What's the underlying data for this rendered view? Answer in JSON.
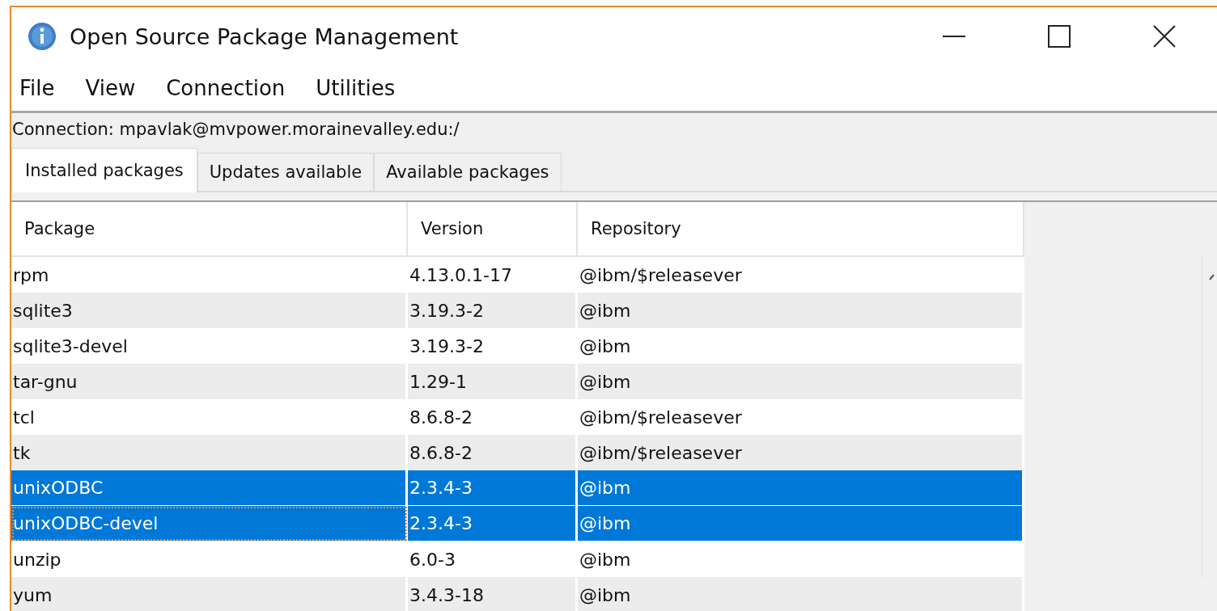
{
  "window": {
    "title": "Open Source Package Management"
  },
  "menu": [
    "File",
    "View",
    "Connection",
    "Utilities"
  ],
  "connection": "Connection: mpavlak@mvpower.morainevalley.edu:/",
  "tabs": [
    {
      "label": "Installed packages",
      "selected": true
    },
    {
      "label": "Updates available",
      "selected": false
    },
    {
      "label": "Available packages",
      "selected": false
    }
  ],
  "table": {
    "columns": [
      "Package",
      "Version",
      "Repository"
    ],
    "rows": [
      {
        "cells": [
          "rpm",
          "4.13.0.1-17",
          "@ibm/$releasever"
        ],
        "selected": false,
        "focused": false
      },
      {
        "cells": [
          "sqlite3",
          "3.19.3-2",
          "@ibm"
        ],
        "selected": false,
        "focused": false
      },
      {
        "cells": [
          "sqlite3-devel",
          "3.19.3-2",
          "@ibm"
        ],
        "selected": false,
        "focused": false
      },
      {
        "cells": [
          "tar-gnu",
          "1.29-1",
          "@ibm"
        ],
        "selected": false,
        "focused": false
      },
      {
        "cells": [
          "tcl",
          "8.6.8-2",
          "@ibm/$releasever"
        ],
        "selected": false,
        "focused": false
      },
      {
        "cells": [
          "tk",
          "8.6.8-2",
          "@ibm/$releasever"
        ],
        "selected": false,
        "focused": false
      },
      {
        "cells": [
          "unixODBC",
          "2.3.4-3",
          "@ibm"
        ],
        "selected": true,
        "focused": false
      },
      {
        "cells": [
          "unixODBC-devel",
          "2.3.4-3",
          "@ibm"
        ],
        "selected": true,
        "focused": true
      },
      {
        "cells": [
          "unzip",
          "6.0-3",
          "@ibm"
        ],
        "selected": false,
        "focused": false
      },
      {
        "cells": [
          "yum",
          "3.4.3-18",
          "@ibm"
        ],
        "selected": false,
        "focused": false
      }
    ]
  }
}
